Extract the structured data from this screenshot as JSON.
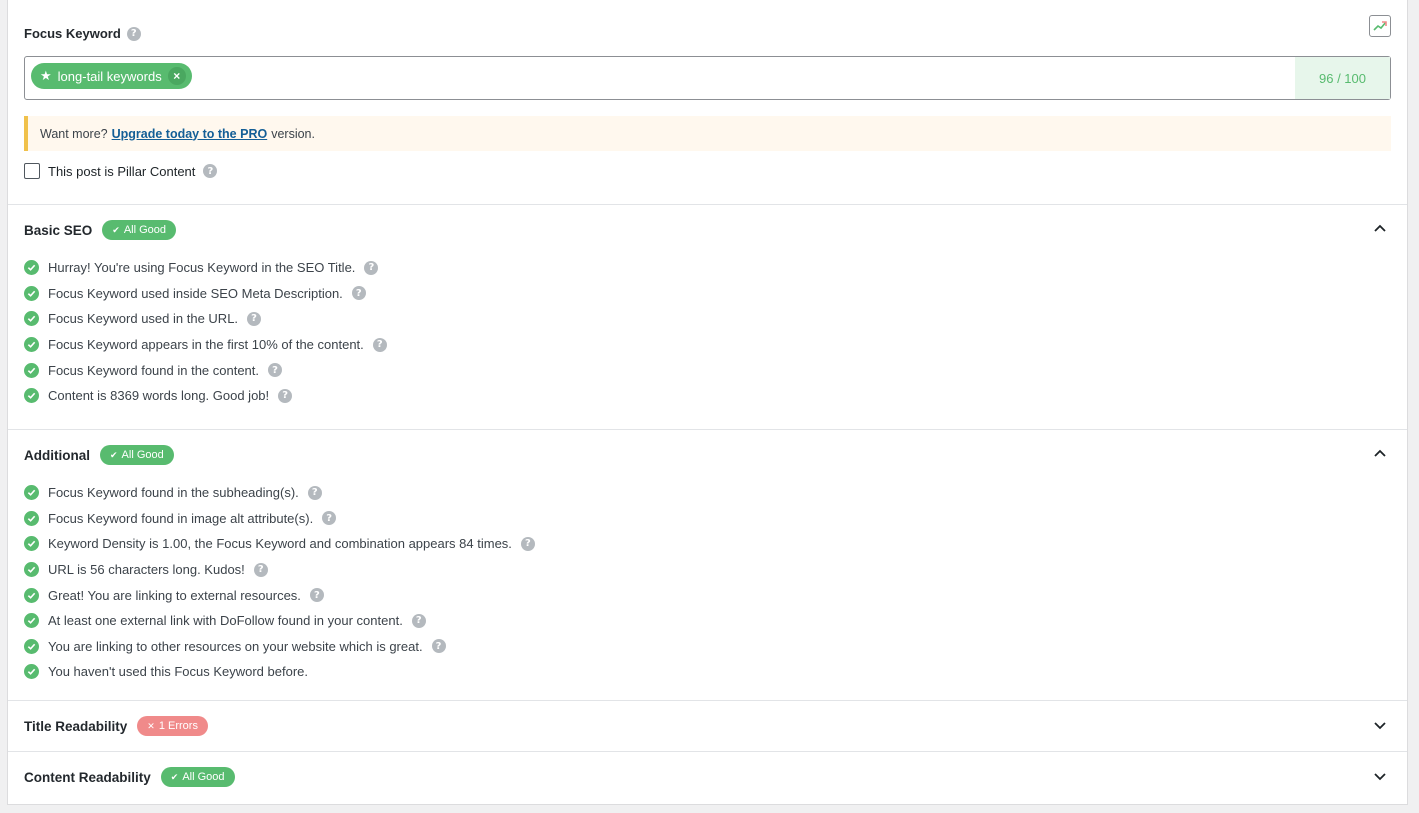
{
  "focus_keyword": {
    "title": "Focus Keyword",
    "help": "?",
    "tag": "long-tail keywords",
    "tag_remove": "×",
    "score": "96 / 100"
  },
  "notice": {
    "prefix": "Want more?",
    "link": "Upgrade today to the PRO",
    "suffix": "version."
  },
  "pillar": {
    "label": "This post is Pillar Content",
    "checked": false
  },
  "sections": [
    {
      "title": "Basic SEO",
      "badge": "All Good",
      "badge_status": "good",
      "expanded": true,
      "items": [
        "Hurray! You're using Focus Keyword in the SEO Title.",
        "Focus Keyword used inside SEO Meta Description.",
        "Focus Keyword used in the URL.",
        "Focus Keyword appears in the first 10% of the content.",
        "Focus Keyword found in the content.",
        "Content is 8369 words long. Good job!"
      ]
    },
    {
      "title": "Additional",
      "badge": "All Good",
      "badge_status": "good",
      "expanded": true,
      "items": [
        "Focus Keyword found in the subheading(s).",
        "Focus Keyword found in image alt attribute(s).",
        "Keyword Density is 1.00, the Focus Keyword and combination appears 84 times.",
        "URL is 56 characters long. Kudos!",
        "Great! You are linking to external resources.",
        "At least one external link with DoFollow found in your content.",
        "You are linking to other resources on your website which is great.",
        "You haven't used this Focus Keyword before."
      ]
    },
    {
      "title": "Title Readability",
      "badge": "1 Errors",
      "badge_status": "bad",
      "expanded": false,
      "items": []
    },
    {
      "title": "Content Readability",
      "badge": "All Good",
      "badge_status": "good",
      "expanded": false,
      "items": []
    }
  ],
  "colors": {
    "good": "#58bb6f",
    "bad": "#f08a8a",
    "link": "#135e96",
    "notice_border": "#f0c14b"
  }
}
